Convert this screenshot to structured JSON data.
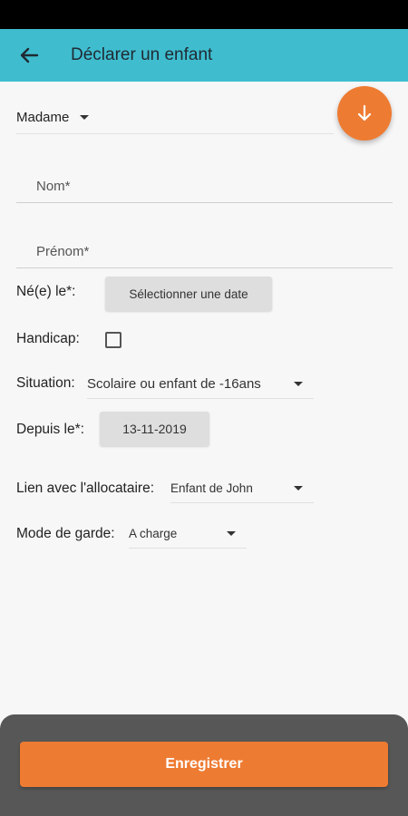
{
  "appbar": {
    "title": "Déclarer un enfant",
    "back_icon": "arrow-left-icon"
  },
  "fab": {
    "icon": "arrow-down-icon",
    "color": "#ee7b32"
  },
  "form": {
    "civility": {
      "value": "Madame"
    },
    "nom": {
      "placeholder": "Nom*"
    },
    "prenom": {
      "placeholder": "Prénom*"
    },
    "birth": {
      "label": "Né(e) le*:",
      "button": "Sélectionner une date"
    },
    "handicap": {
      "label": "Handicap:",
      "checked": false
    },
    "situation": {
      "label": "Situation:",
      "value": "Scolaire ou enfant de -16ans"
    },
    "since": {
      "label": "Depuis le*:",
      "value": "13-11-2019"
    },
    "link": {
      "label": "Lien avec l'allocataire:",
      "value": "Enfant de John"
    },
    "custody": {
      "label": "Mode de garde:",
      "value": "A charge"
    }
  },
  "footer": {
    "save_label": "Enregistrer"
  },
  "colors": {
    "appbar": "#3fbdcf",
    "accent": "#ee7b32",
    "footer": "#575757"
  }
}
